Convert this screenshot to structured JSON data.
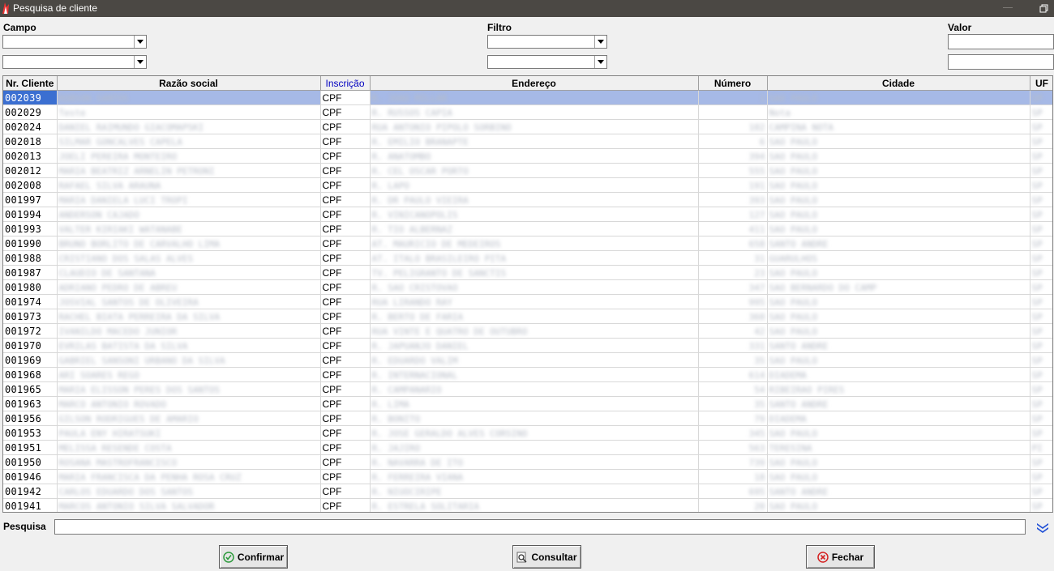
{
  "window": {
    "title": "Pesquisa de cliente"
  },
  "filters": {
    "campo_label": "Campo",
    "filtro_label": "Filtro",
    "valor_label": "Valor"
  },
  "table": {
    "columns": [
      "Nr. Cliente",
      "Razão social",
      "Inscrição",
      "Endereço",
      "Número",
      "Cidade",
      "UF"
    ],
    "rows": [
      [
        "002039",
        "ROBSON SANTOS",
        "CPF",
        "R. JOAO MILLAR",
        "1",
        "SAO PAULO",
        "SP"
      ],
      [
        "002029",
        "Teste",
        "CPF",
        "R. RUSSOS CAPIA",
        "",
        "Nota",
        "SP"
      ],
      [
        "002024",
        "DANIEL RAIMUNDO GIACOMAPSKI",
        "CPF",
        "RUA ANTONIO PIPOLO SORBINO",
        "102",
        "CAMPINA NOTA",
        "SP"
      ],
      [
        "002018",
        "SILMAR GONCALVES CAPELA",
        "CPF",
        "R. EMILIO BRANAPTE",
        "6",
        "SAO PAULO",
        "SP"
      ],
      [
        "002013",
        "JOELI PEREIRA MONTEIRO",
        "CPF",
        "R. ANATOMBO",
        "394",
        "SAO PAULO",
        "SP"
      ],
      [
        "002012",
        "MARIA BEATRIZ ARNELIN PETRONI",
        "CPF",
        "R. CEL OSCAR PORTO",
        "555",
        "SAO PAULO",
        "SP"
      ],
      [
        "002008",
        "RAFAEL SILVA ARAUNA",
        "CPF",
        "R. LAPO",
        "191",
        "SAO PAULO",
        "SP"
      ],
      [
        "001997",
        "MARIA DANIELA LUCI TROPI",
        "CPF",
        "R. DR PAULO VIEIRA",
        "393",
        "SAO PAULO",
        "SP"
      ],
      [
        "001994",
        "ANDERSON CAJADO",
        "CPF",
        "R. VINICANOPOLIS",
        "127",
        "SAO PAULO",
        "SP"
      ],
      [
        "001993",
        "VALTER KIRIAKI WATANABE",
        "CPF",
        "R. TIO ALBERNAZ",
        "411",
        "SAO PAULO",
        "SP"
      ],
      [
        "001990",
        "BRUNO BORLITO DE CARVALHO LIMA",
        "CPF",
        "AT. MAURICIO DE MEDEIROS",
        "658",
        "SANTO ANDRE",
        "SP"
      ],
      [
        "001988",
        "CRISTIANO DOS SALAS ALVES",
        "CPF",
        "AT. ITALO BRASILEIRO PITA",
        "31",
        "GUARULHOS",
        "SP"
      ],
      [
        "001987",
        "CLAUDIO DE SANTANA",
        "CPF",
        "TV. PELIGRANTO DE SANCTIS",
        "23",
        "SAO PAULO",
        "SP"
      ],
      [
        "001980",
        "ADRIANO PEDRO DE ABREU",
        "CPF",
        "R. SAO CRISTOVAO",
        "347",
        "SAO BERNARDO DO CAMP",
        "SP"
      ],
      [
        "001974",
        "JOSVIAL SANTOS DE OLIVEIRA",
        "CPF",
        "RUA LIRANDO RAY",
        "995",
        "SAO PAULO",
        "SP"
      ],
      [
        "001973",
        "RACHEL BIATA PERREIRA DA SILVA",
        "CPF",
        "R. BERTO DE FARIA",
        "360",
        "SAO PAULO",
        "SP"
      ],
      [
        "001972",
        "IVANILDO MACEDO JUNIOR",
        "CPF",
        "RUA VINTE E QUATRO DE OUTUBRO",
        "42",
        "SAO PAULO",
        "SP"
      ],
      [
        "001970",
        "EVRILAS BATISTA DA SILVA",
        "CPF",
        "R. JAPUANJO DANIEL",
        "331",
        "SANTO ANDRE",
        "SP"
      ],
      [
        "001969",
        "GABRIEL SANSONI URBANO DA SILVA",
        "CPF",
        "R. EDUARDO VALIM",
        "35",
        "SAO PAULO",
        "SP"
      ],
      [
        "001968",
        "ARI SOARES REGO",
        "CPF",
        "R. INTERNACIONAL",
        "614",
        "DIADEMA",
        "SP"
      ],
      [
        "001965",
        "MARIA ELISSON PERES DOS SANTOS",
        "CPF",
        "R. CAMPANARIO",
        "54",
        "RIBEIRAO PIRES",
        "SP"
      ],
      [
        "001963",
        "MARCO ANTONIO ROVADO",
        "CPF",
        "R. LIMA",
        "35",
        "SANTO ANDRE",
        "SP"
      ],
      [
        "001956",
        "GILSON RODRIGUES DE AMARIO",
        "CPF",
        "R. BONITO",
        "79",
        "DIADEMA",
        "SP"
      ],
      [
        "001953",
        "PAULA ENY HIRATSUKI",
        "CPF",
        "R. JOSE GERALDO ALVES CORSINO",
        "345",
        "SAO PAULO",
        "SP"
      ],
      [
        "001951",
        "MELISSA RESENDE COSTA",
        "CPF",
        "R. JAJIRO",
        "563",
        "TERESINA",
        "PI"
      ],
      [
        "001950",
        "ROSANA MASTROFRANCISCO",
        "CPF",
        "R. NAVARRA DE ITO",
        "739",
        "SAO PAULO",
        "SP"
      ],
      [
        "001946",
        "MARIA FRANCISCA DA PENHA ROSA CRUZ",
        "CPF",
        "R. FERREIRA VIANA",
        "18",
        "SAO PAULO",
        "SP"
      ],
      [
        "001942",
        "CARLOS EDUARDO DOS SANTOS",
        "CPF",
        "R. NIUOCIRIPE",
        "695",
        "SANTO ANDRE",
        "SP"
      ],
      [
        "001941",
        "MARCOS ANTONIO SILVA SALVADOR",
        "CPF",
        "R. ESTRELA SOLITARIA",
        "20",
        "SAO PAULO",
        "SP"
      ]
    ]
  },
  "search": {
    "label": "Pesquisa"
  },
  "buttons": {
    "confirm": "Confirmar",
    "query": "Consultar",
    "close": "Fechar"
  },
  "colors": {
    "titlebar": "#4b4844",
    "selection": "#3b6fd1",
    "selection_row": "#a6b9e6",
    "inscricao_header": "#0000c0"
  },
  "icons": {
    "app": "flame-icon",
    "confirm": "check-circle-icon",
    "query": "search-document-icon",
    "close": "x-circle-icon",
    "expand": "double-chevron-down-icon"
  }
}
